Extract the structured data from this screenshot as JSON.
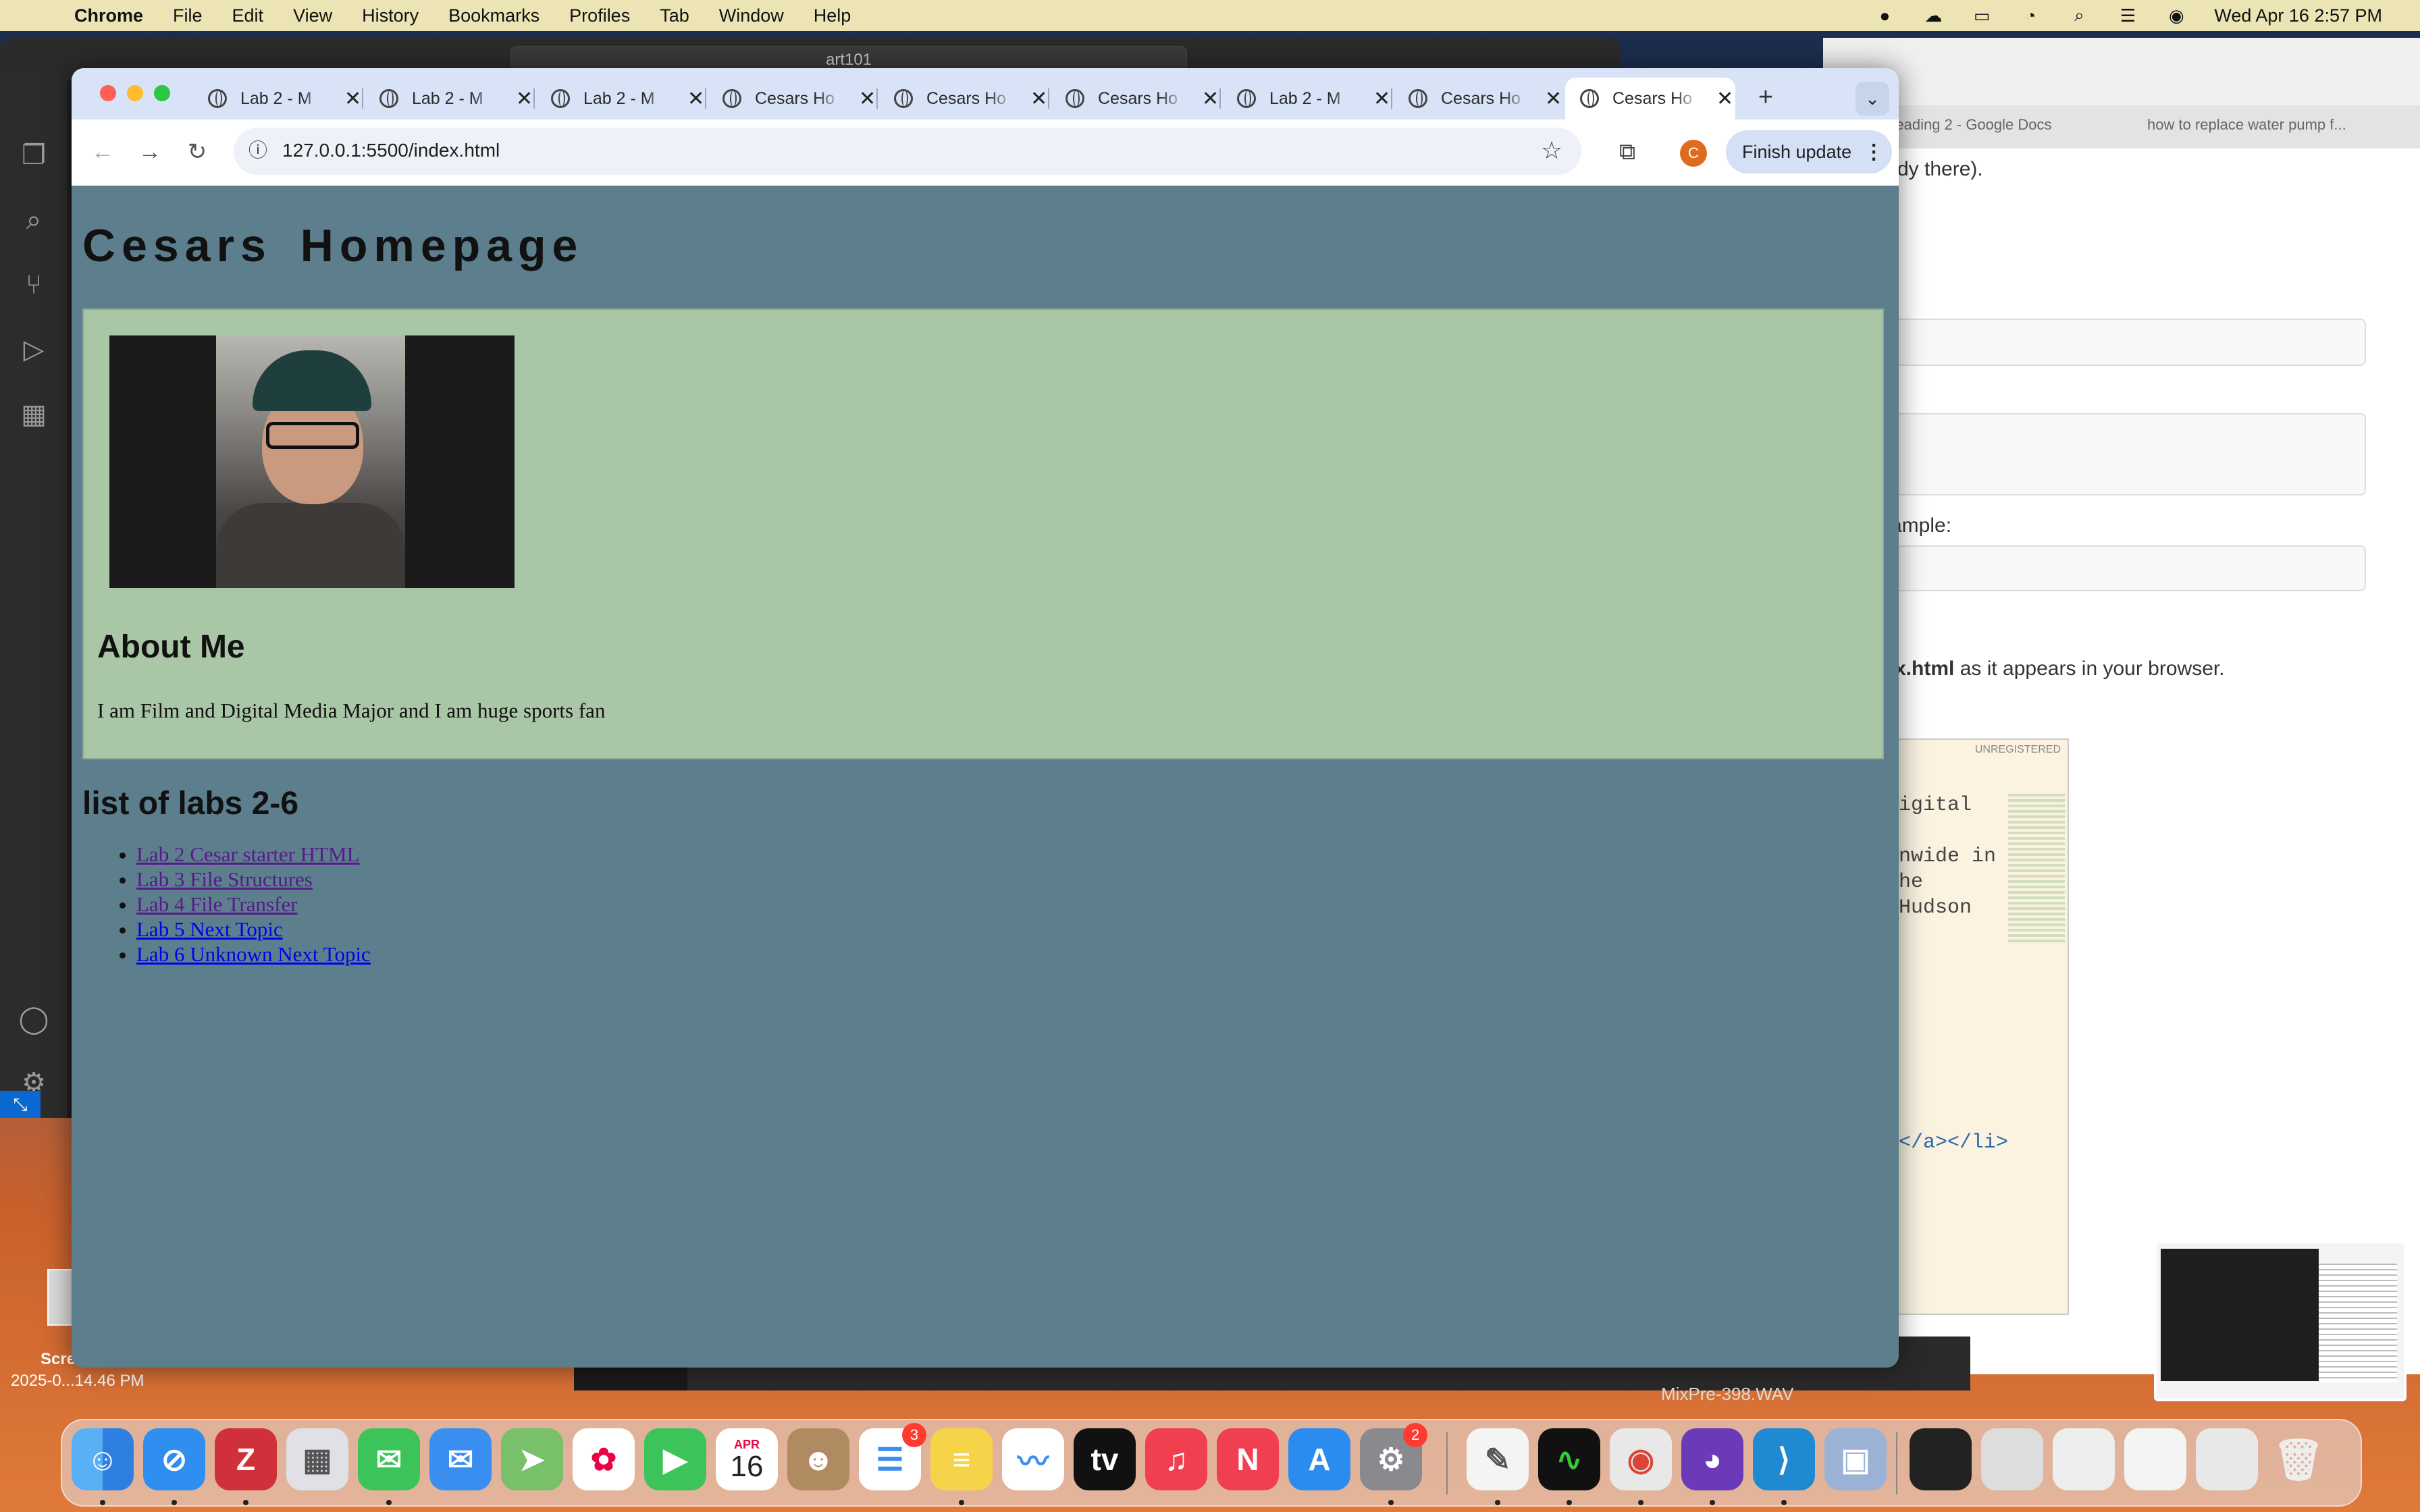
{
  "menubar": {
    "app_name": "Chrome",
    "items": [
      "File",
      "Edit",
      "View",
      "History",
      "Bookmarks",
      "Profiles",
      "Tab",
      "Window",
      "Help"
    ],
    "datetime": "Wed Apr 16  2:57 PM"
  },
  "vscode": {
    "search_text": "art101"
  },
  "background_doc": {
    "tab1": "Reading 2 - Google Docs",
    "tab2": "how to replace water pump f...",
    "line1": "dy there).",
    "line2": "ample:",
    "line3_bold": "x.html",
    "line3_rest": " as it appears in your browser."
  },
  "sublime": {
    "badge": "UNREGISTERED",
    "lines": [
      "igital",
      "nwide in",
      "he",
      "Hudson"
    ],
    "tag_line": "</a></li>"
  },
  "desktop": {
    "file_line1": "Scre",
    "file_line2": "2025-0...14.46 PM",
    "wav_name": "MixPre-398.WAV"
  },
  "chrome": {
    "tabs": [
      {
        "title": "Lab 2 - M"
      },
      {
        "title": "Lab 2 - M"
      },
      {
        "title": "Lab 2 - M"
      },
      {
        "title": "Cesars Ho"
      },
      {
        "title": "Cesars Ho"
      },
      {
        "title": "Cesars Ho"
      },
      {
        "title": "Lab 2 - M"
      },
      {
        "title": "Cesars Ho"
      },
      {
        "title": "Cesars Ho"
      }
    ],
    "active_tab_index": 8,
    "url": "127.0.0.1:5500/index.html",
    "profile_initial": "C",
    "finish_update_label": "Finish update"
  },
  "page": {
    "title": "Cesars Homepage",
    "about_heading": "About Me",
    "about_text": "I am Film and Digital Media Major and I am huge sports fan",
    "labs_heading": "list of labs 2-6",
    "labs": [
      {
        "label": "Lab 2 Cesar starter HTML",
        "visited": true
      },
      {
        "label": "Lab 3 File Structures",
        "visited": true
      },
      {
        "label": "Lab 4 File Transfer",
        "visited": true
      },
      {
        "label": "Lab 5 Next Topic",
        "visited": false
      },
      {
        "label": "Lab 6 Unknown Next Topic",
        "visited": false
      }
    ]
  },
  "dock": {
    "calendar_month": "APR",
    "calendar_day": "16",
    "reminders_badge": "3",
    "settings_badge": "2",
    "icons": [
      "finder-icon",
      "safari-icon",
      "zotero-icon",
      "launchpad-icon",
      "messages-icon",
      "mail-icon",
      "maps-icon",
      "photos-icon",
      "facetime-icon",
      "calendar-icon",
      "contacts-icon",
      "reminders-icon",
      "notes-icon",
      "freeform-icon",
      "appletv-icon",
      "music-icon",
      "news-icon",
      "appstore-icon",
      "settings-icon",
      "textedit-icon",
      "activity-monitor-icon",
      "chrome-icon",
      "github-icon",
      "vscode-icon",
      "preview-icon"
    ],
    "colors": {
      "finder": "#3a8ef0",
      "safari": "#2f8ff0",
      "zotero": "#d0303a",
      "messages": "#3cc45a",
      "mail": "#3a8ef0",
      "facetime": "#3cc45a",
      "music": "#f0404f",
      "news": "#f04050",
      "appstore": "#2b8cf0",
      "chrome": "#e8e8e8",
      "github": "#6a3ab8",
      "vscode": "#1f8ad2"
    }
  }
}
